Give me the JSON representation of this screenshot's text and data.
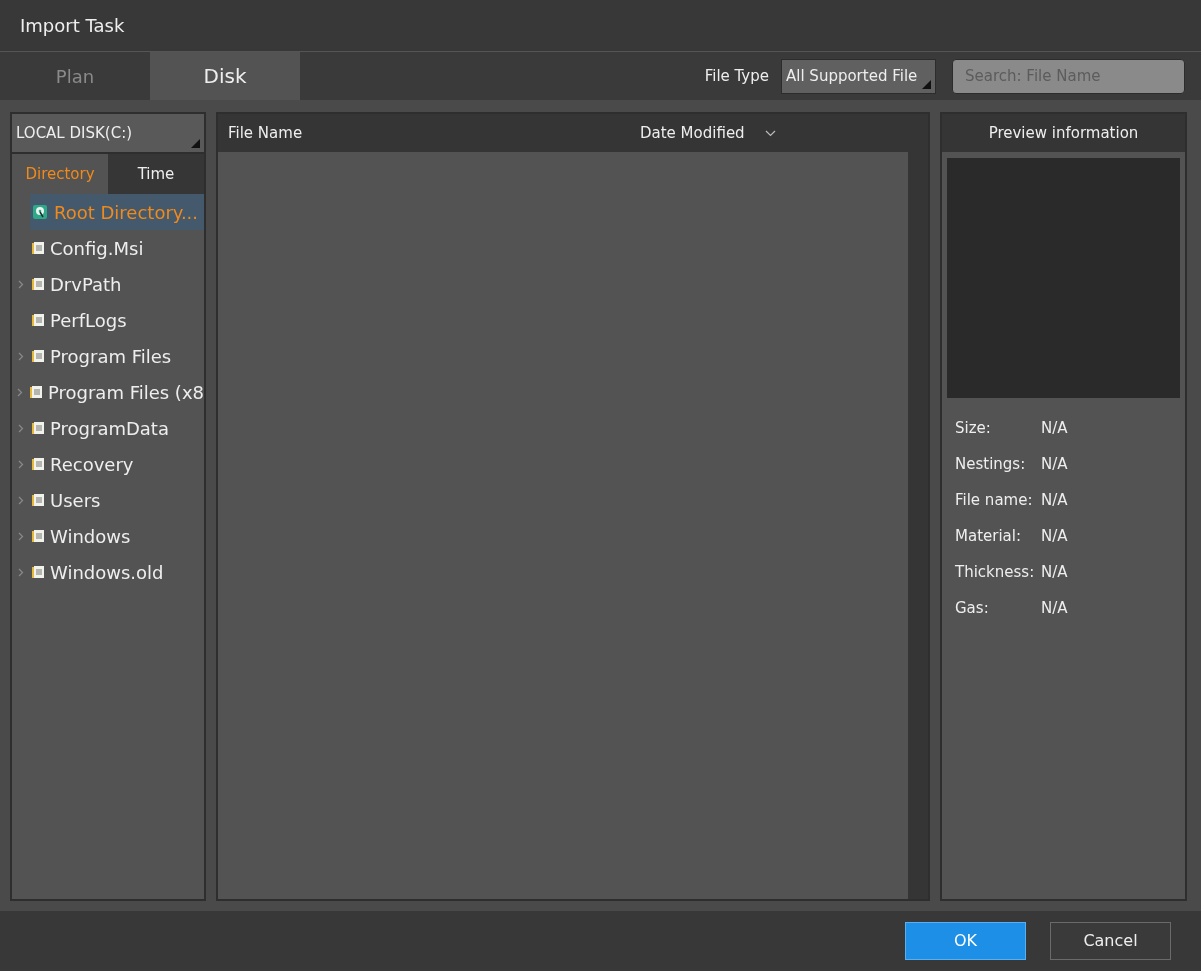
{
  "window": {
    "title": "Import Task"
  },
  "tabs": [
    {
      "label": "Plan",
      "selected": false
    },
    {
      "label": "Disk",
      "selected": true
    }
  ],
  "file_type": {
    "label": "File Type",
    "value": "All Supported File"
  },
  "search": {
    "placeholder": "Search: File Name"
  },
  "disk_select": {
    "value": "LOCAL DISK(C:)"
  },
  "side_tabs": [
    {
      "label": "Directory",
      "selected": true
    },
    {
      "label": "Time",
      "selected": false
    }
  ],
  "tree": [
    {
      "label": "Root Directory...",
      "kind": "disk",
      "selected": true,
      "expandable": false
    },
    {
      "label": "Config.Msi",
      "kind": "folder",
      "selected": false,
      "expandable": false
    },
    {
      "label": "DrvPath",
      "kind": "folder",
      "selected": false,
      "expandable": true
    },
    {
      "label": "PerfLogs",
      "kind": "folder",
      "selected": false,
      "expandable": false
    },
    {
      "label": "Program Files",
      "kind": "folder",
      "selected": false,
      "expandable": true
    },
    {
      "label": "Program Files (x8",
      "kind": "folder",
      "selected": false,
      "expandable": true
    },
    {
      "label": "ProgramData",
      "kind": "folder",
      "selected": false,
      "expandable": true
    },
    {
      "label": "Recovery",
      "kind": "folder",
      "selected": false,
      "expandable": true
    },
    {
      "label": "Users",
      "kind": "folder",
      "selected": false,
      "expandable": true
    },
    {
      "label": "Windows",
      "kind": "folder",
      "selected": false,
      "expandable": true
    },
    {
      "label": "Windows.old",
      "kind": "folder",
      "selected": false,
      "expandable": true
    }
  ],
  "table": {
    "columns": [
      "File Name",
      "Date Modified"
    ]
  },
  "preview": {
    "title": "Preview information",
    "fields": [
      {
        "label": "Size:",
        "value": "N/A"
      },
      {
        "label": "Nestings:",
        "value": "N/A"
      },
      {
        "label": "File name:",
        "value": "N/A"
      },
      {
        "label": "Material:",
        "value": "N/A"
      },
      {
        "label": "Thickness:",
        "value": "N/A"
      },
      {
        "label": "Gas:",
        "value": "N/A"
      }
    ]
  },
  "buttons": [
    {
      "label": "OK",
      "kind": "primary"
    },
    {
      "label": "Cancel",
      "kind": "secondary"
    }
  ]
}
